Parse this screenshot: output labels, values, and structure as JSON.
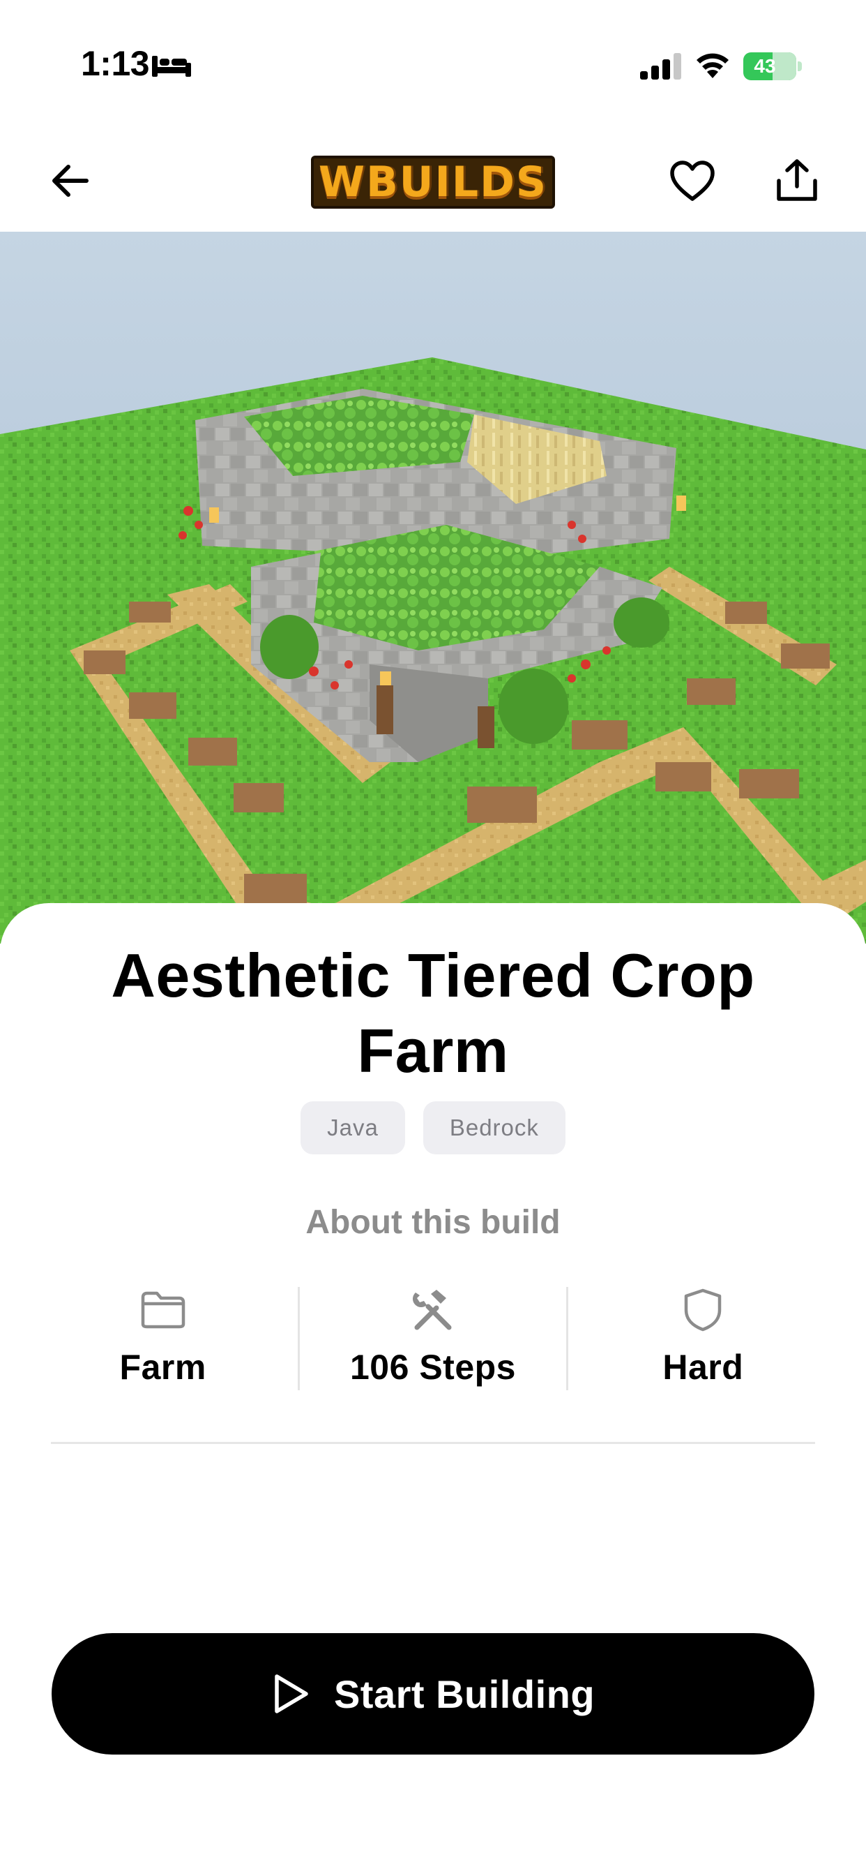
{
  "status_bar": {
    "time": "1:13",
    "battery": "43",
    "icons": [
      "bed-icon",
      "cellular-signal-icon",
      "wifi-icon",
      "battery-icon"
    ]
  },
  "nav": {
    "logo_text": "WBUILDS",
    "icons": [
      "arrow-left-icon",
      "heart-icon",
      "share-icon"
    ]
  },
  "hero": {
    "image": "minecraft-crop-farm-render"
  },
  "build": {
    "title": "Aesthetic Tiered Crop Farm",
    "tags": [
      "Java",
      "Bedrock"
    ],
    "about_heading": "About this build",
    "stats": [
      {
        "icon": "folder-icon",
        "value": "Farm"
      },
      {
        "icon": "hammer-wrench-icon",
        "value": "106 Steps"
      },
      {
        "icon": "shield-icon",
        "value": "Hard"
      }
    ]
  },
  "cta": {
    "label": "Start Building",
    "icon": "play-icon"
  },
  "colors": {
    "accent": "#000000",
    "tag_bg": "#eeeef2",
    "muted_text": "#8c8c8c",
    "battery": "#34c759",
    "logo": "#f4a81c"
  }
}
